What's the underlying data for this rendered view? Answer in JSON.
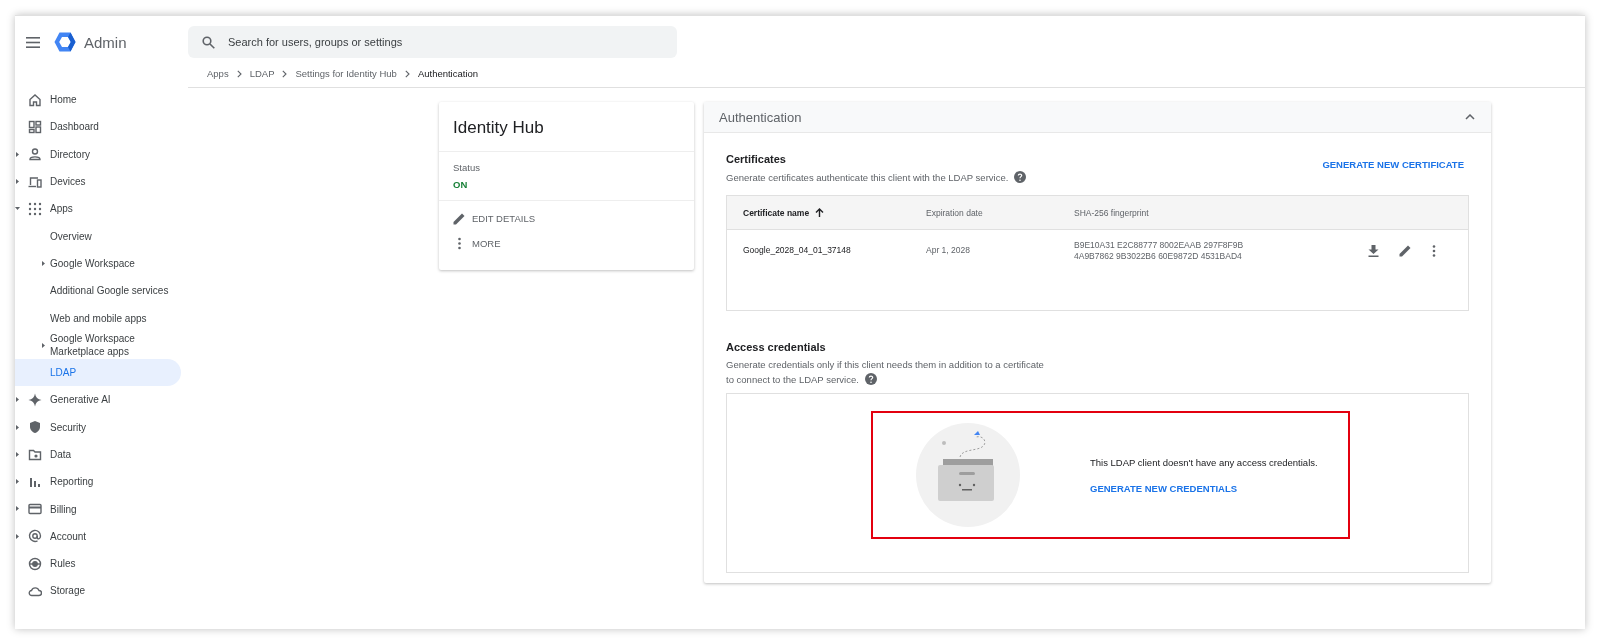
{
  "app": {
    "title": "Admin"
  },
  "search": {
    "placeholder": "Search for users, groups or settings"
  },
  "breadcrumb": [
    "Apps",
    "LDAP",
    "Settings for Identity Hub",
    "Authentication"
  ],
  "sidebar": {
    "items": [
      {
        "label": "Home",
        "expandable": false,
        "selected": false
      },
      {
        "label": "Dashboard",
        "expandable": false,
        "selected": false
      },
      {
        "label": "Directory",
        "expandable": true,
        "expanded": false,
        "selected": false
      },
      {
        "label": "Devices",
        "expandable": true,
        "expanded": false,
        "selected": false
      },
      {
        "label": "Apps",
        "expandable": true,
        "expanded": true,
        "selected": false,
        "children": [
          {
            "label": "Overview",
            "expandable": false,
            "selected": false
          },
          {
            "label": "Google Workspace",
            "expandable": true,
            "expanded": false,
            "selected": false
          },
          {
            "label": "Additional Google services",
            "expandable": false,
            "selected": false
          },
          {
            "label": "Web and mobile apps",
            "expandable": false,
            "selected": false
          },
          {
            "label": "Google Workspace Marketplace apps",
            "expandable": true,
            "expanded": false,
            "selected": false
          },
          {
            "label": "LDAP",
            "expandable": false,
            "selected": true
          }
        ]
      },
      {
        "label": "Generative AI",
        "expandable": true,
        "expanded": false,
        "selected": false
      },
      {
        "label": "Security",
        "expandable": true,
        "expanded": false,
        "selected": false
      },
      {
        "label": "Data",
        "expandable": true,
        "expanded": false,
        "selected": false
      },
      {
        "label": "Reporting",
        "expandable": true,
        "expanded": false,
        "selected": false
      },
      {
        "label": "Billing",
        "expandable": true,
        "expanded": false,
        "selected": false
      },
      {
        "label": "Account",
        "expandable": true,
        "expanded": false,
        "selected": false
      },
      {
        "label": "Rules",
        "expandable": false,
        "selected": false
      },
      {
        "label": "Storage",
        "expandable": false,
        "selected": false
      }
    ]
  },
  "client_card": {
    "title": "Identity Hub",
    "status_label": "Status",
    "status": "ON",
    "status_on": true,
    "actions": [
      "EDIT DETAILS",
      "MORE"
    ]
  },
  "authentication": {
    "title": "Authentication",
    "expanded": true,
    "certificates": {
      "title": "Certificates",
      "description": "Generate certificates authenticate this client with the LDAP service.",
      "action": "GENERATE NEW CERTIFICATE",
      "table": {
        "columns": [
          "Certificate name",
          "Expiration date",
          "SHA-256 fingerprint"
        ],
        "rows": [
          {
            "name": "Google_2028_04_01_37148",
            "expiration": "Apr 1, 2028",
            "fingerprint": [
              "B9E10A31 E2C88777 8002EAAB 297F8F9B",
              "4A9B7862 9B3022B6 60E9872D 4531BAD4"
            ]
          }
        ]
      }
    },
    "access_credentials": {
      "title": "Access credentials",
      "description": [
        "Generate credentials only if this client needs them in addition to a certificate",
        "to connect to the LDAP service."
      ],
      "empty_message": "This LDAP client doesn't have any access credentials.",
      "action": "GENERATE NEW CREDENTIALS"
    }
  }
}
